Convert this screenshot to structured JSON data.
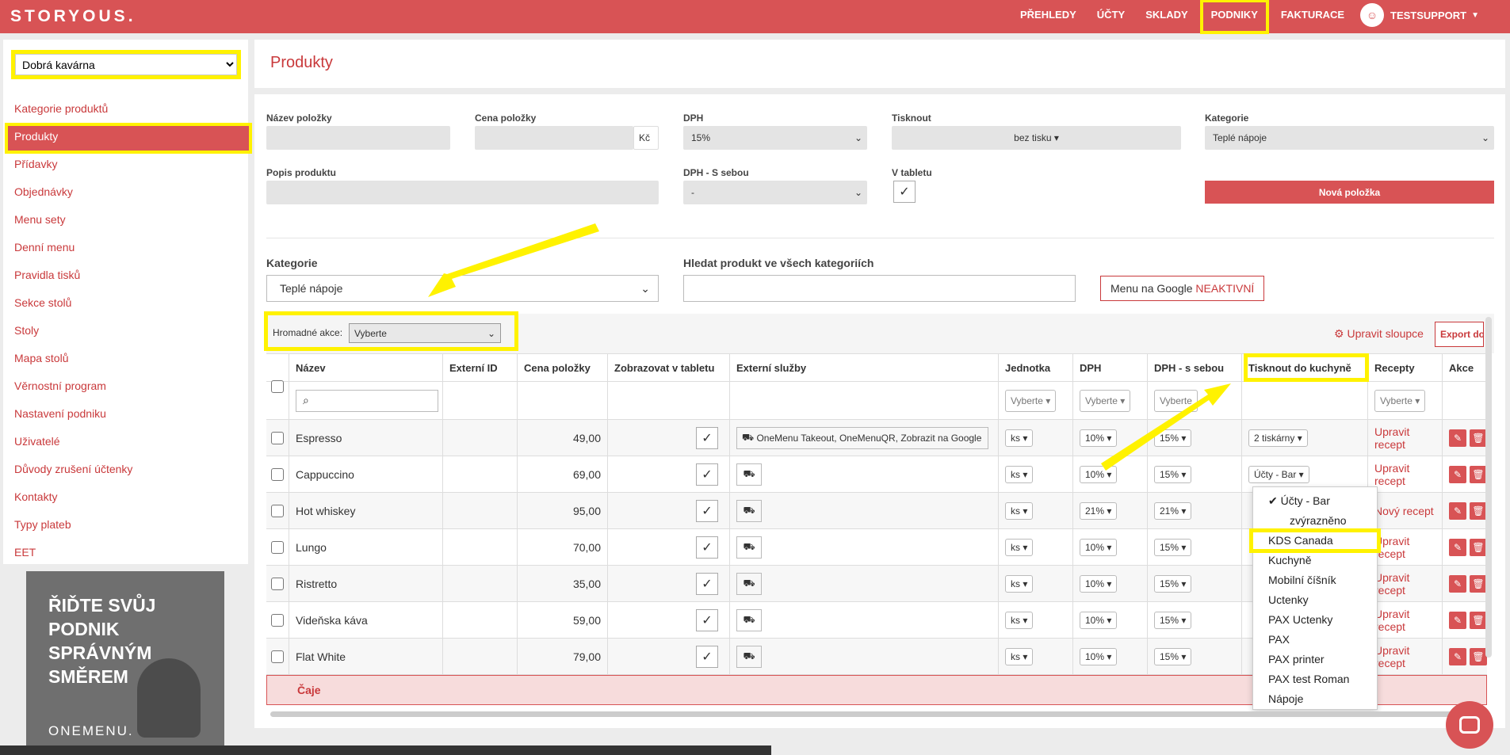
{
  "brand": "STORYOUS.",
  "nav": [
    {
      "label": "PŘEHLEDY"
    },
    {
      "label": "ÚČTY"
    },
    {
      "label": "SKLADY"
    },
    {
      "label": "PODNIKY"
    },
    {
      "label": "FAKTURACE"
    }
  ],
  "user": {
    "name": "TESTSUPPORT"
  },
  "venue_select": "Dobrá kavárna",
  "sidebar": [
    "Kategorie produktů",
    "Produkty",
    "Přídavky",
    "Objednávky",
    "Menu sety",
    "Denní menu",
    "Pravidla tisků",
    "Sekce stolů",
    "Stoly",
    "Mapa stolů",
    "Věrnostní program",
    "Nastavení podniku",
    "Uživatelé",
    "Důvody zrušení účtenky",
    "Kontakty",
    "Typy plateb",
    "EET"
  ],
  "ad": {
    "text": "ŘIĎTE SVŮJ PODNIK SPRÁVNÝM SMĚREM",
    "brand": "ONEMENU."
  },
  "page_title": "Produkty",
  "form": {
    "name_label": "Název položky",
    "price_label": "Cena položky",
    "currency": "Kč",
    "vat_label": "DPH",
    "vat_value": "15%",
    "print_label": "Tisknout",
    "print_value": "bez tisku",
    "category_label": "Kategorie",
    "category_value": "Teplé nápoje",
    "desc_label": "Popis produktu",
    "vat_takeaway_label": "DPH - S sebou",
    "vat_takeaway_value": "-",
    "tablet_label": "V tabletu",
    "new_item": "Nová položka"
  },
  "filter": {
    "category_label": "Kategorie",
    "category_value": "Teplé nápoje",
    "search_label": "Hledat produkt ve všech kategoriích",
    "google_menu": "Menu na Google",
    "google_status": "NEAKTIVNÍ"
  },
  "bulk": {
    "label": "Hromadné akce:",
    "value": "Vyberte",
    "edit_columns": "Upravit sloupce",
    "export": "Export do"
  },
  "columns": [
    "Název",
    "Externí ID",
    "Cena položky",
    "Zobrazovat v tabletu",
    "Externí služby",
    "Jednotka",
    "DPH",
    "DPH - s sebou",
    "Tisknout do kuchyně",
    "Recepty",
    "Akce"
  ],
  "filter_placeholder": "Vyberte",
  "rows": [
    {
      "name": "Espresso",
      "price": "49,00",
      "services": "OneMenu Takeout, OneMenuQR, Zobrazit na Google",
      "unit": "ks",
      "vat": "10%",
      "vat_to": "15%",
      "kitchen": "2 tiskárny",
      "recipe": "Upravit recept"
    },
    {
      "name": "Cappuccino",
      "price": "69,00",
      "services": "",
      "unit": "ks",
      "vat": "10%",
      "vat_to": "15%",
      "kitchen": "Účty - Bar",
      "recipe": "Upravit recept"
    },
    {
      "name": "Hot whiskey",
      "price": "95,00",
      "services": "",
      "unit": "ks",
      "vat": "21%",
      "vat_to": "21%",
      "kitchen": "",
      "recipe": "Nový recept"
    },
    {
      "name": "Lungo",
      "price": "70,00",
      "services": "",
      "unit": "ks",
      "vat": "10%",
      "vat_to": "15%",
      "kitchen": "",
      "recipe": "Upravit recept"
    },
    {
      "name": "Ristretto",
      "price": "35,00",
      "services": "",
      "unit": "ks",
      "vat": "10%",
      "vat_to": "15%",
      "kitchen": "",
      "recipe": "Upravit recept"
    },
    {
      "name": "Videňska káva",
      "price": "59,00",
      "services": "",
      "unit": "ks",
      "vat": "10%",
      "vat_to": "15%",
      "kitchen": "",
      "recipe": "Upravit recept"
    },
    {
      "name": "Flat White",
      "price": "79,00",
      "services": "",
      "unit": "ks",
      "vat": "10%",
      "vat_to": "15%",
      "kitchen": "",
      "recipe": "Upravit recept"
    }
  ],
  "category_row": "Čaje",
  "dropdown": {
    "checked": "Účty - Bar",
    "checked_sub": "zvýrazněno",
    "items": [
      "KDS Canada",
      "Kuchyně",
      "Mobilní číšník",
      "Uctenky",
      "PAX Uctenky",
      "PAX",
      "PAX printer",
      "PAX test Roman",
      "Nápoje"
    ]
  },
  "colors": {
    "brand": "#d85355",
    "highlight": "#fff200"
  }
}
